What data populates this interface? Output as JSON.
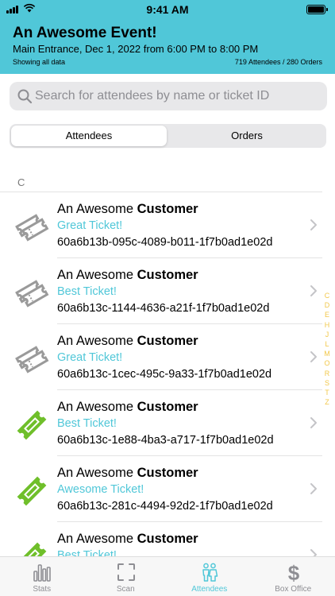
{
  "status": {
    "time": "9:41 AM"
  },
  "event": {
    "title": "An Awesome Event!",
    "subtitle": "Main Entrance, Dec  1, 2022 from 6:00 PM to 8:00 PM",
    "filter": "Showing all data",
    "counts": "719 Attendees / 280 Orders"
  },
  "search": {
    "placeholder": "Search for attendees by name or ticket ID",
    "value": ""
  },
  "segments": [
    {
      "label": "Attendees",
      "selected": true
    },
    {
      "label": "Orders",
      "selected": false
    }
  ],
  "section": {
    "header": "C"
  },
  "attendees": [
    {
      "first": "An Awesome ",
      "last": "Customer",
      "ticket": "Great Ticket!",
      "id": "60a6b13b-095c-4089-b011-1f7b0ad1e02d",
      "checked_in": false
    },
    {
      "first": "An Awesome ",
      "last": "Customer",
      "ticket": "Best Ticket!",
      "id": "60a6b13c-1144-4636-a21f-1f7b0ad1e02d",
      "checked_in": false
    },
    {
      "first": "An Awesome ",
      "last": "Customer",
      "ticket": "Great Ticket!",
      "id": "60a6b13c-1cec-495c-9a33-1f7b0ad1e02d",
      "checked_in": false
    },
    {
      "first": "An Awesome ",
      "last": "Customer",
      "ticket": "Best Ticket!",
      "id": "60a6b13c-1e88-4ba3-a717-1f7b0ad1e02d",
      "checked_in": true
    },
    {
      "first": "An Awesome ",
      "last": "Customer",
      "ticket": "Awesome Ticket!",
      "id": "60a6b13c-281c-4494-92d2-1f7b0ad1e02d",
      "checked_in": true
    },
    {
      "first": "An Awesome ",
      "last": "Customer",
      "ticket": "Best Ticket!",
      "id": "",
      "checked_in": true
    }
  ],
  "index_letters": [
    "C",
    "D",
    "E",
    "H",
    "J",
    "L",
    "M",
    "O",
    "R",
    "S",
    "T",
    "Z"
  ],
  "tabs": [
    {
      "label": "Stats",
      "icon": "bar-chart-icon",
      "active": false
    },
    {
      "label": "Scan",
      "icon": "scan-icon",
      "active": false
    },
    {
      "label": "Attendees",
      "icon": "people-icon",
      "active": true
    },
    {
      "label": "Box Office",
      "icon": "dollar-icon",
      "active": false
    }
  ],
  "colors": {
    "accent": "#50c7d8",
    "checked_in": "#6fbf2a",
    "not_checked_in": "#9a9a9a",
    "index": "#f2c84b",
    "tab_inactive": "#8e8e93"
  }
}
